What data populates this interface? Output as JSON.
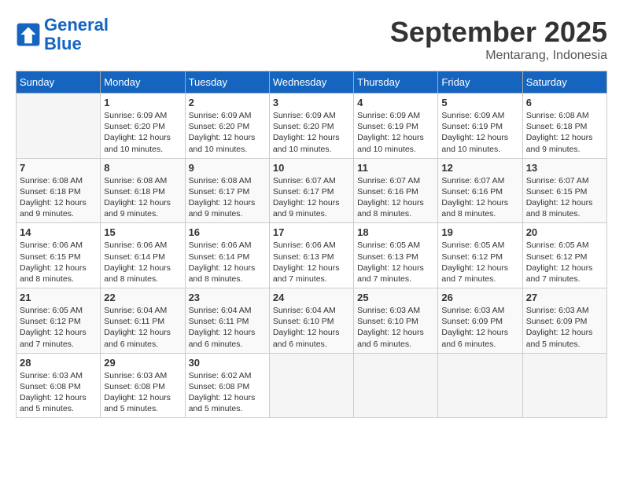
{
  "header": {
    "logo_line1": "General",
    "logo_line2": "Blue",
    "month": "September 2025",
    "location": "Mentarang, Indonesia"
  },
  "weekdays": [
    "Sunday",
    "Monday",
    "Tuesday",
    "Wednesday",
    "Thursday",
    "Friday",
    "Saturday"
  ],
  "weeks": [
    [
      {
        "day": "",
        "info": ""
      },
      {
        "day": "1",
        "info": "Sunrise: 6:09 AM\nSunset: 6:20 PM\nDaylight: 12 hours\nand 10 minutes."
      },
      {
        "day": "2",
        "info": "Sunrise: 6:09 AM\nSunset: 6:20 PM\nDaylight: 12 hours\nand 10 minutes."
      },
      {
        "day": "3",
        "info": "Sunrise: 6:09 AM\nSunset: 6:20 PM\nDaylight: 12 hours\nand 10 minutes."
      },
      {
        "day": "4",
        "info": "Sunrise: 6:09 AM\nSunset: 6:19 PM\nDaylight: 12 hours\nand 10 minutes."
      },
      {
        "day": "5",
        "info": "Sunrise: 6:09 AM\nSunset: 6:19 PM\nDaylight: 12 hours\nand 10 minutes."
      },
      {
        "day": "6",
        "info": "Sunrise: 6:08 AM\nSunset: 6:18 PM\nDaylight: 12 hours\nand 9 minutes."
      }
    ],
    [
      {
        "day": "7",
        "info": "Sunrise: 6:08 AM\nSunset: 6:18 PM\nDaylight: 12 hours\nand 9 minutes."
      },
      {
        "day": "8",
        "info": "Sunrise: 6:08 AM\nSunset: 6:18 PM\nDaylight: 12 hours\nand 9 minutes."
      },
      {
        "day": "9",
        "info": "Sunrise: 6:08 AM\nSunset: 6:17 PM\nDaylight: 12 hours\nand 9 minutes."
      },
      {
        "day": "10",
        "info": "Sunrise: 6:07 AM\nSunset: 6:17 PM\nDaylight: 12 hours\nand 9 minutes."
      },
      {
        "day": "11",
        "info": "Sunrise: 6:07 AM\nSunset: 6:16 PM\nDaylight: 12 hours\nand 8 minutes."
      },
      {
        "day": "12",
        "info": "Sunrise: 6:07 AM\nSunset: 6:16 PM\nDaylight: 12 hours\nand 8 minutes."
      },
      {
        "day": "13",
        "info": "Sunrise: 6:07 AM\nSunset: 6:15 PM\nDaylight: 12 hours\nand 8 minutes."
      }
    ],
    [
      {
        "day": "14",
        "info": "Sunrise: 6:06 AM\nSunset: 6:15 PM\nDaylight: 12 hours\nand 8 minutes."
      },
      {
        "day": "15",
        "info": "Sunrise: 6:06 AM\nSunset: 6:14 PM\nDaylight: 12 hours\nand 8 minutes."
      },
      {
        "day": "16",
        "info": "Sunrise: 6:06 AM\nSunset: 6:14 PM\nDaylight: 12 hours\nand 8 minutes."
      },
      {
        "day": "17",
        "info": "Sunrise: 6:06 AM\nSunset: 6:13 PM\nDaylight: 12 hours\nand 7 minutes."
      },
      {
        "day": "18",
        "info": "Sunrise: 6:05 AM\nSunset: 6:13 PM\nDaylight: 12 hours\nand 7 minutes."
      },
      {
        "day": "19",
        "info": "Sunrise: 6:05 AM\nSunset: 6:12 PM\nDaylight: 12 hours\nand 7 minutes."
      },
      {
        "day": "20",
        "info": "Sunrise: 6:05 AM\nSunset: 6:12 PM\nDaylight: 12 hours\nand 7 minutes."
      }
    ],
    [
      {
        "day": "21",
        "info": "Sunrise: 6:05 AM\nSunset: 6:12 PM\nDaylight: 12 hours\nand 7 minutes."
      },
      {
        "day": "22",
        "info": "Sunrise: 6:04 AM\nSunset: 6:11 PM\nDaylight: 12 hours\nand 6 minutes."
      },
      {
        "day": "23",
        "info": "Sunrise: 6:04 AM\nSunset: 6:11 PM\nDaylight: 12 hours\nand 6 minutes."
      },
      {
        "day": "24",
        "info": "Sunrise: 6:04 AM\nSunset: 6:10 PM\nDaylight: 12 hours\nand 6 minutes."
      },
      {
        "day": "25",
        "info": "Sunrise: 6:03 AM\nSunset: 6:10 PM\nDaylight: 12 hours\nand 6 minutes."
      },
      {
        "day": "26",
        "info": "Sunrise: 6:03 AM\nSunset: 6:09 PM\nDaylight: 12 hours\nand 6 minutes."
      },
      {
        "day": "27",
        "info": "Sunrise: 6:03 AM\nSunset: 6:09 PM\nDaylight: 12 hours\nand 5 minutes."
      }
    ],
    [
      {
        "day": "28",
        "info": "Sunrise: 6:03 AM\nSunset: 6:08 PM\nDaylight: 12 hours\nand 5 minutes."
      },
      {
        "day": "29",
        "info": "Sunrise: 6:03 AM\nSunset: 6:08 PM\nDaylight: 12 hours\nand 5 minutes."
      },
      {
        "day": "30",
        "info": "Sunrise: 6:02 AM\nSunset: 6:08 PM\nDaylight: 12 hours\nand 5 minutes."
      },
      {
        "day": "",
        "info": ""
      },
      {
        "day": "",
        "info": ""
      },
      {
        "day": "",
        "info": ""
      },
      {
        "day": "",
        "info": ""
      }
    ]
  ]
}
